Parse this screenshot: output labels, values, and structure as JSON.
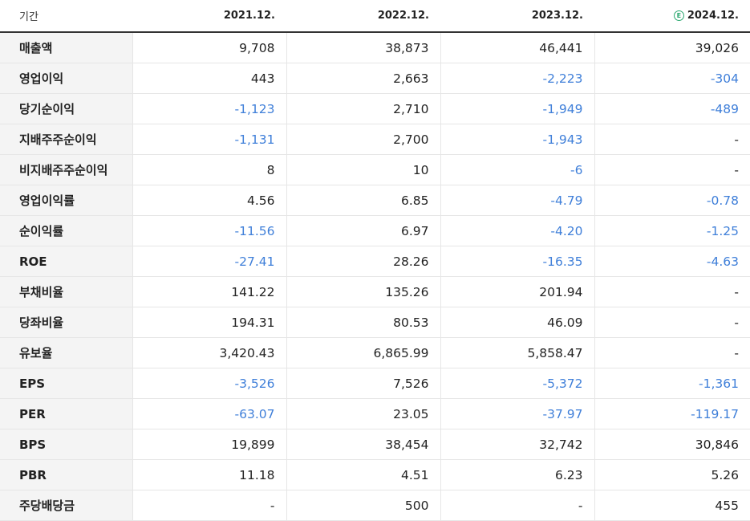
{
  "header": {
    "period_label": "기간",
    "years": [
      "2021.12.",
      "2022.12.",
      "2023.12.",
      "2024.12."
    ],
    "estimate_icon_text": "E"
  },
  "rows": [
    {
      "label": "매출액",
      "values": [
        "9,708",
        "38,873",
        "46,441",
        "39,026"
      ]
    },
    {
      "label": "영업이익",
      "values": [
        "443",
        "2,663",
        "-2,223",
        "-304"
      ]
    },
    {
      "label": "당기순이익",
      "values": [
        "-1,123",
        "2,710",
        "-1,949",
        "-489"
      ]
    },
    {
      "label": "지배주주순이익",
      "values": [
        "-1,131",
        "2,700",
        "-1,943",
        "-"
      ]
    },
    {
      "label": "비지배주주순이익",
      "values": [
        "8",
        "10",
        "-6",
        "-"
      ]
    },
    {
      "label": "영업이익률",
      "values": [
        "4.56",
        "6.85",
        "-4.79",
        "-0.78"
      ]
    },
    {
      "label": "순이익률",
      "values": [
        "-11.56",
        "6.97",
        "-4.20",
        "-1.25"
      ]
    },
    {
      "label": "ROE",
      "values": [
        "-27.41",
        "28.26",
        "-16.35",
        "-4.63"
      ]
    },
    {
      "label": "부채비율",
      "values": [
        "141.22",
        "135.26",
        "201.94",
        "-"
      ]
    },
    {
      "label": "당좌비율",
      "values": [
        "194.31",
        "80.53",
        "46.09",
        "-"
      ]
    },
    {
      "label": "유보율",
      "values": [
        "3,420.43",
        "6,865.99",
        "5,858.47",
        "-"
      ]
    },
    {
      "label": "EPS",
      "values": [
        "-3,526",
        "7,526",
        "-5,372",
        "-1,361"
      ]
    },
    {
      "label": "PER",
      "values": [
        "-63.07",
        "23.05",
        "-37.97",
        "-119.17"
      ]
    },
    {
      "label": "BPS",
      "values": [
        "19,899",
        "38,454",
        "32,742",
        "30,846"
      ]
    },
    {
      "label": "PBR",
      "values": [
        "11.18",
        "4.51",
        "6.23",
        "5.26"
      ]
    },
    {
      "label": "주당배당금",
      "values": [
        "-",
        "500",
        "-",
        "455"
      ]
    }
  ],
  "colors": {
    "negative": "#3f7fd9",
    "estimate": "#2ba870",
    "label_bg": "#f4f4f4"
  }
}
